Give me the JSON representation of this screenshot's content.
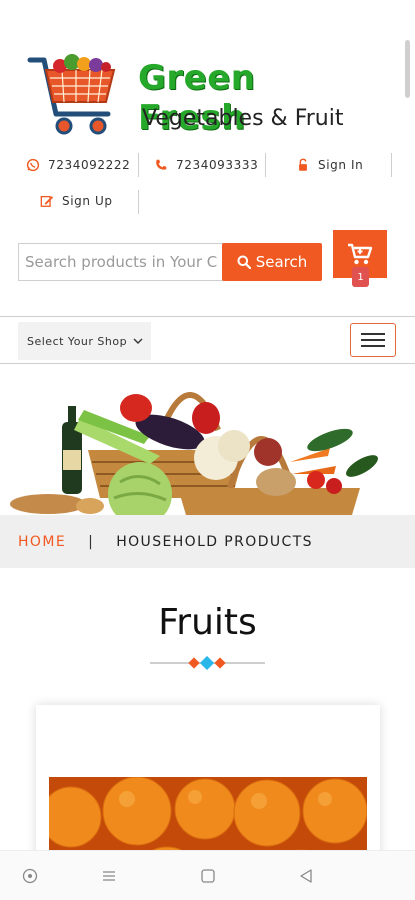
{
  "header": {
    "brand_title": "Green Fresh",
    "brand_subtitle": "Vegetables & Fruit"
  },
  "contact": {
    "whatsapp": "7234092222",
    "phone": "7234093333",
    "sign_in": "Sign In",
    "sign_up": "Sign Up"
  },
  "search": {
    "placeholder": "Search products in Your City",
    "button_label": "Search"
  },
  "cart": {
    "count": "1"
  },
  "nav": {
    "shop_select": "Select Your Shop"
  },
  "breadcrumb": {
    "home": "HOME",
    "separator": "|",
    "current": "HOUSEHOLD PRODUCTS"
  },
  "section": {
    "title": "Fruits"
  },
  "colors": {
    "accent": "#f05a22",
    "brand_green": "#26a82b",
    "divider_blue": "#29b6e8"
  },
  "icons": [
    "whatsapp-icon",
    "phone-icon",
    "lock-icon",
    "edit-icon",
    "search-icon",
    "cart-icon",
    "chevron-down-icon",
    "menu-icon"
  ]
}
